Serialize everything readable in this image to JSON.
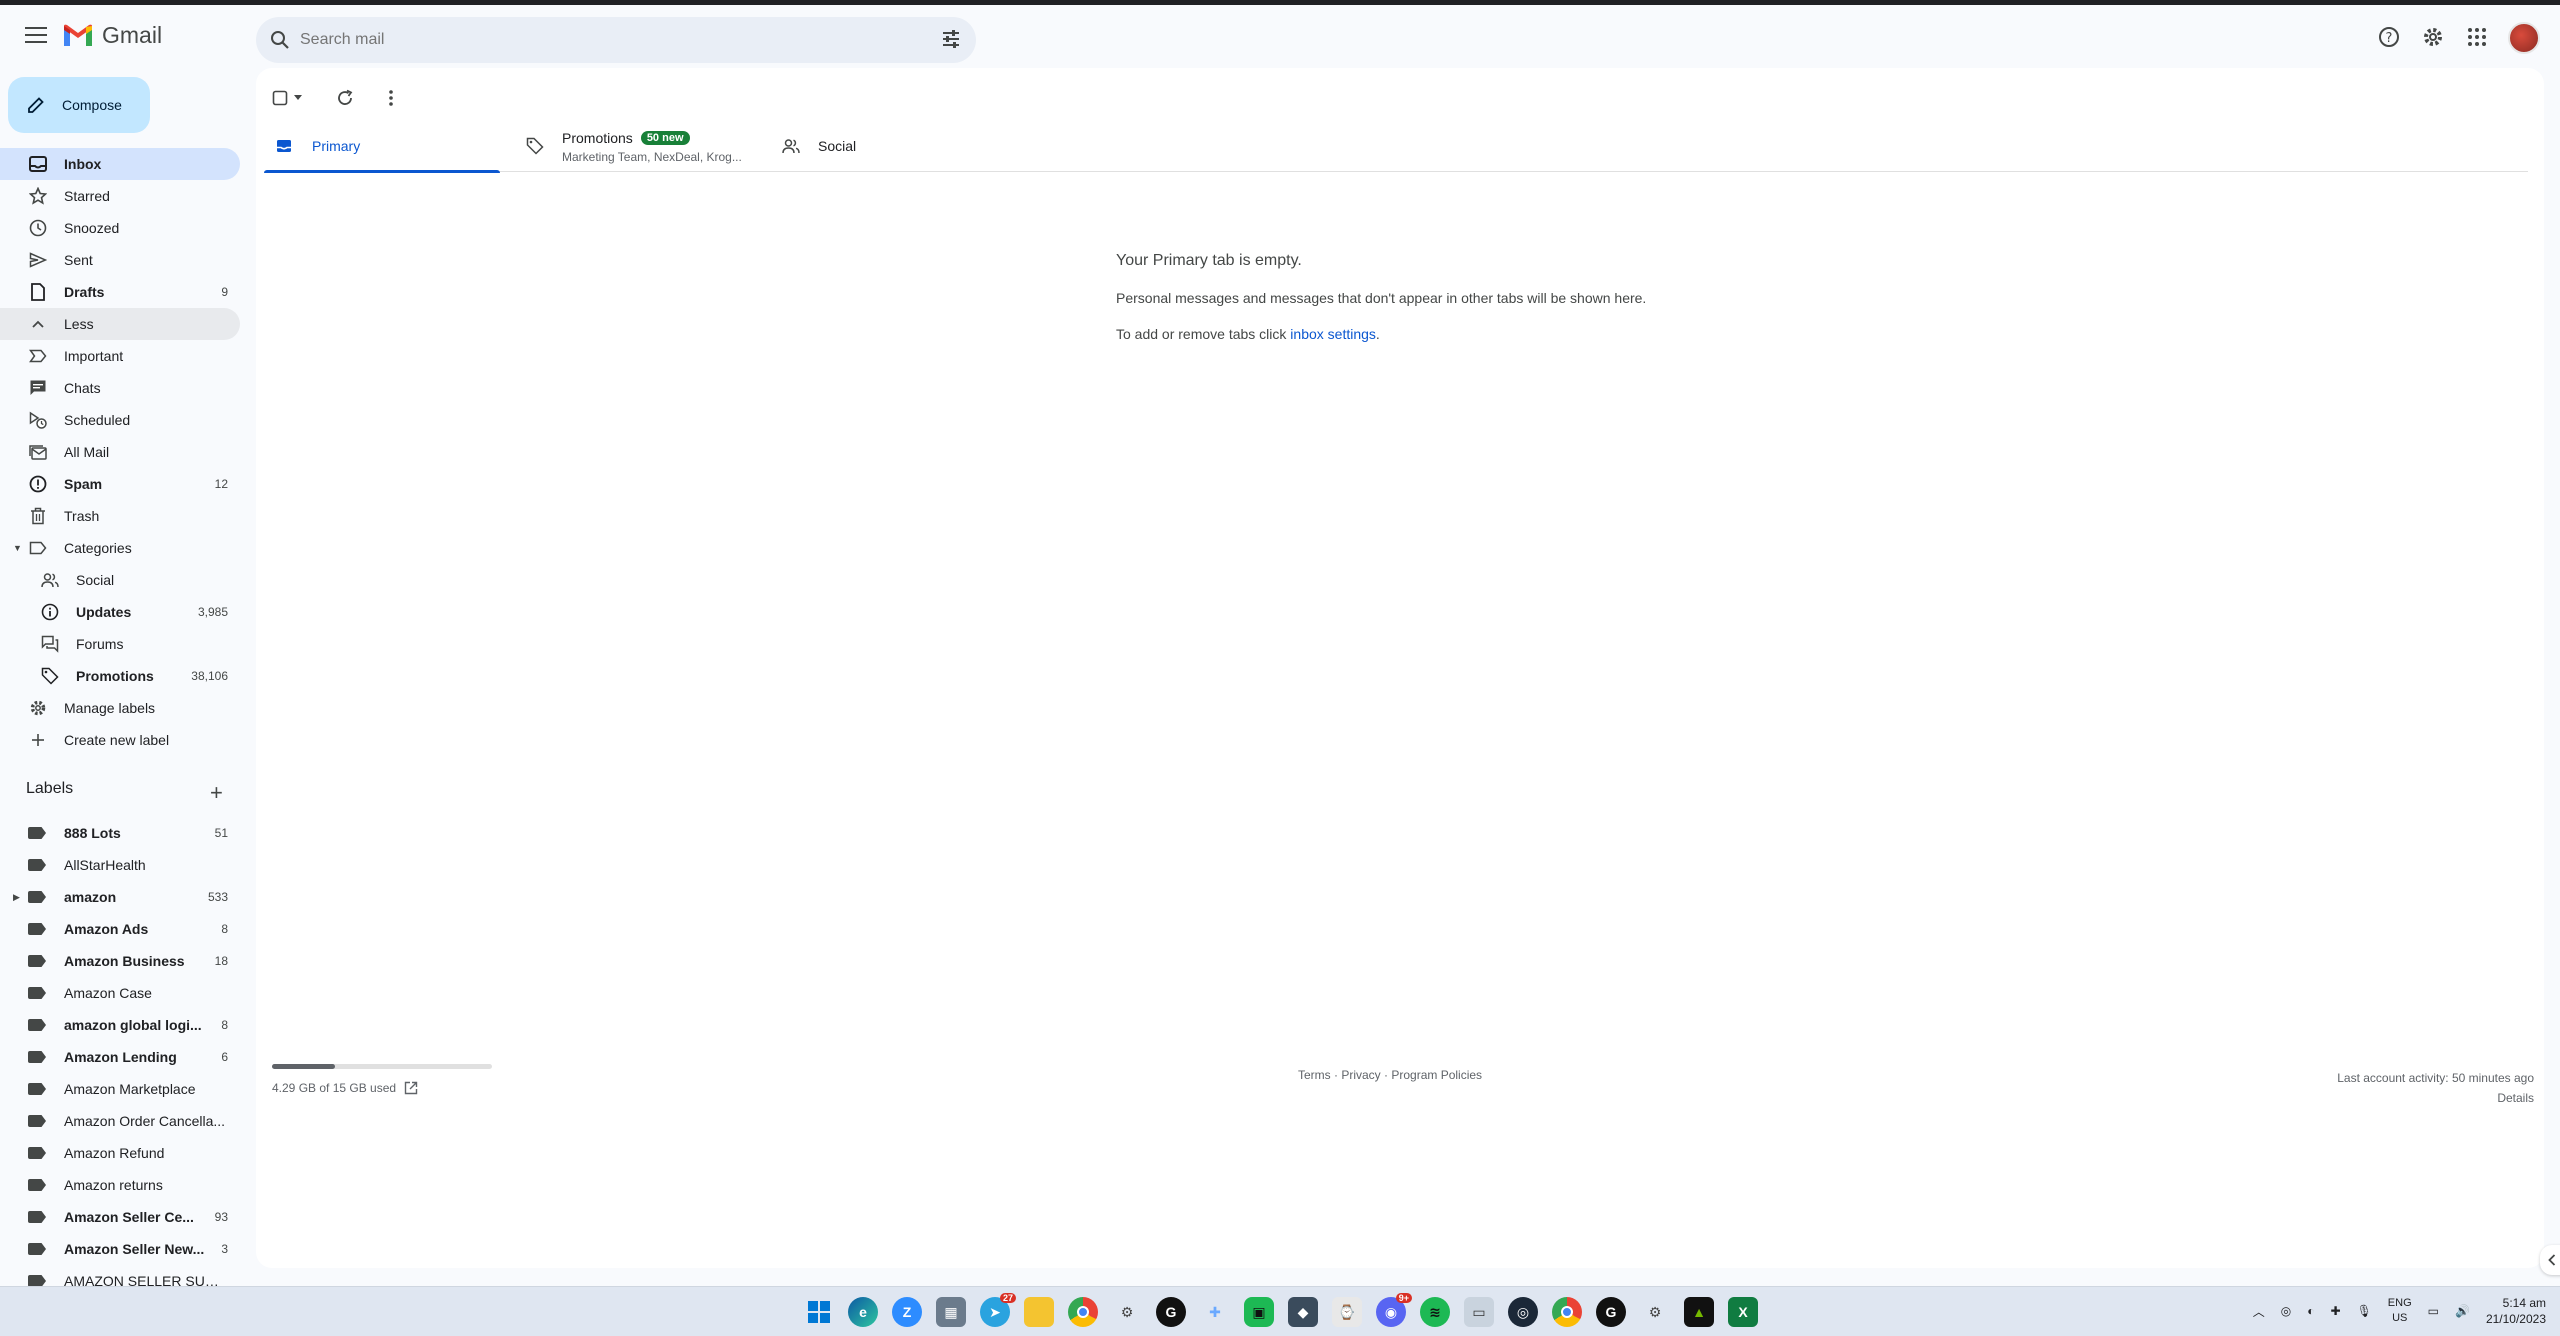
{
  "app": {
    "name": "Gmail"
  },
  "search": {
    "placeholder": "Search mail"
  },
  "compose": {
    "label": "Compose"
  },
  "nav": [
    {
      "label": "Inbox",
      "count": "",
      "icon": "inbox-icon"
    },
    {
      "label": "Starred",
      "count": "",
      "icon": "star-icon"
    },
    {
      "label": "Snoozed",
      "count": "",
      "icon": "clock-icon"
    },
    {
      "label": "Sent",
      "count": "",
      "icon": "send-icon"
    },
    {
      "label": "Drafts",
      "count": "9",
      "icon": "draft-icon"
    },
    {
      "label": "Less",
      "count": "",
      "icon": "chevron-up-icon"
    },
    {
      "label": "Important",
      "count": "",
      "icon": "important-icon"
    },
    {
      "label": "Chats",
      "count": "",
      "icon": "chat-icon"
    },
    {
      "label": "Scheduled",
      "count": "",
      "icon": "scheduled-icon"
    },
    {
      "label": "All Mail",
      "count": "",
      "icon": "all-mail-icon"
    },
    {
      "label": "Spam",
      "count": "12",
      "icon": "spam-icon"
    },
    {
      "label": "Trash",
      "count": "",
      "icon": "trash-icon"
    },
    {
      "label": "Categories",
      "count": "",
      "icon": "label-outline-icon"
    },
    {
      "label": "Social",
      "count": "",
      "icon": "people-icon"
    },
    {
      "label": "Updates",
      "count": "3,985",
      "icon": "info-icon"
    },
    {
      "label": "Forums",
      "count": "",
      "icon": "forum-icon"
    },
    {
      "label": "Promotions",
      "count": "38,106",
      "icon": "tag-icon"
    },
    {
      "label": "Manage labels",
      "count": "",
      "icon": "gear-icon"
    },
    {
      "label": "Create new label",
      "count": "",
      "icon": "plus-icon"
    }
  ],
  "labels_section": {
    "title": "Labels"
  },
  "labels": [
    {
      "label": "888 Lots",
      "count": "51"
    },
    {
      "label": "AllStarHealth",
      "count": ""
    },
    {
      "label": "amazon",
      "count": "533"
    },
    {
      "label": "Amazon Ads",
      "count": "8"
    },
    {
      "label": "Amazon Business",
      "count": "18"
    },
    {
      "label": "Amazon Case",
      "count": ""
    },
    {
      "label": "amazon global logi...",
      "count": "8"
    },
    {
      "label": "Amazon Lending",
      "count": "6"
    },
    {
      "label": "Amazon Marketplace",
      "count": ""
    },
    {
      "label": "Amazon Order Cancella...",
      "count": ""
    },
    {
      "label": "Amazon Refund",
      "count": ""
    },
    {
      "label": "Amazon returns",
      "count": ""
    },
    {
      "label": "Amazon Seller Ce...",
      "count": "93"
    },
    {
      "label": "Amazon Seller New...",
      "count": "3"
    },
    {
      "label": "AMAZON SELLER SUPP...",
      "count": ""
    }
  ],
  "tabs": {
    "primary": "Primary",
    "promotions": "Promotions",
    "promotions_badge": "50 new",
    "promotions_senders": "Marketing Team, NexDeal, Krog...",
    "social": "Social"
  },
  "empty": {
    "title": "Your Primary tab is empty.",
    "line1": "Personal messages and messages that don't appear in other tabs will be shown here.",
    "line2_prefix": "To add or remove tabs click ",
    "line2_link": "inbox settings",
    "line2_suffix": "."
  },
  "footer": {
    "storage_text": "4.29 GB of 15 GB used",
    "storage_fraction": 0.286,
    "terms": "Terms",
    "sep1": " · ",
    "privacy": "Privacy",
    "sep2": " · ",
    "policies": "Program Policies",
    "activity": "Last account activity: 50 minutes ago",
    "details": "Details"
  },
  "taskbar": {
    "telegram_badge": "27",
    "discord_badge": "9+",
    "lang": "ENG",
    "region": "US",
    "time": "5:14 am",
    "date": "21/10/2023"
  }
}
